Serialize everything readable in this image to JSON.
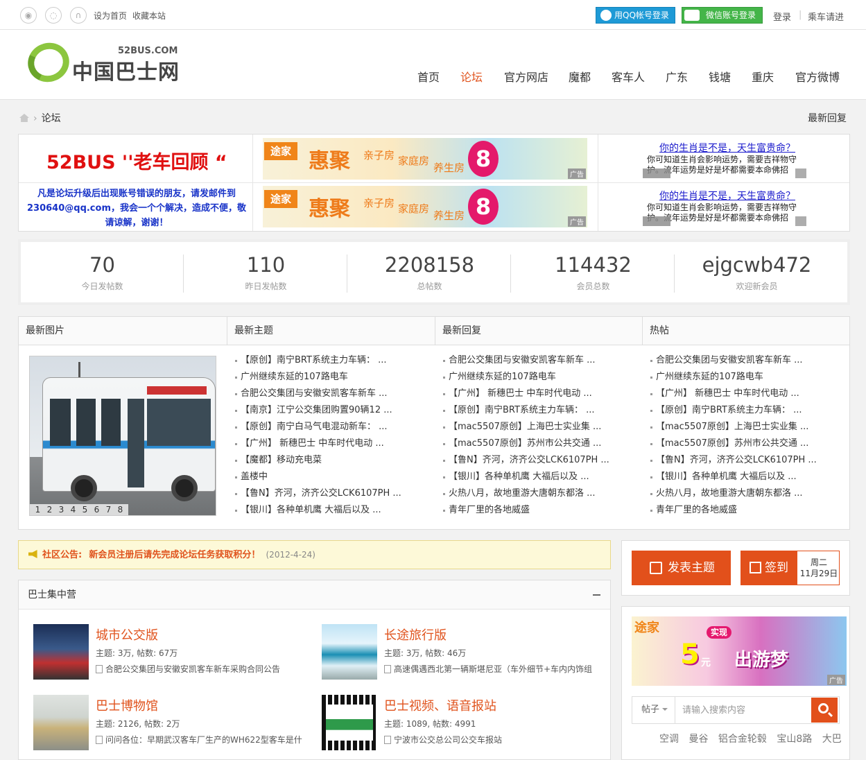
{
  "topbar": {
    "set_home": "设为首页",
    "bookmark": "收藏本站",
    "qq_login": "用QQ帐号登录",
    "wechat_login": "微信账号登录",
    "login": "登录",
    "sep": "|",
    "register": "乘车请进"
  },
  "logo": {
    "text": "中国巴士网",
    "sub": "52BUS.COM"
  },
  "nav": [
    "首页",
    "论坛",
    "官方网店",
    "魔都",
    "客车人",
    "广东",
    "钱塘",
    "重庆",
    "官方微博"
  ],
  "breadcrumb": {
    "current": "论坛",
    "right": "最新回复"
  },
  "ads": {
    "left_title": "52BUS ''老车回顾 “",
    "left_note": "凡是论坛升级后出现账号错误的朋友，请发邮件到230640@qq.com，我会一个个解决，造成不便，敬请谅解，谢谢！",
    "banner_brand": "途家",
    "banner_main": "惠聚",
    "banner_t1": "亲子房",
    "banner_t2": "家庭房",
    "banner_t3": "养生房",
    "banner_num": "8",
    "ad_label": "广告",
    "text_title": "你的生肖是不是，天生富贵命？",
    "text_body": "你可知道生肖会影响运势，需要吉祥物守护。流年运势是好是坏都需要本命佛招"
  },
  "stats": [
    {
      "value": "70",
      "label": "今日发帖数"
    },
    {
      "value": "110",
      "label": "昨日发帖数"
    },
    {
      "value": "2208158",
      "label": "总帖数"
    },
    {
      "value": "114432",
      "label": "会员总数"
    },
    {
      "value": "ejgcwb472",
      "label": "欢迎新会员"
    }
  ],
  "panel": {
    "h_pics": "最新图片",
    "h_topics": "最新主题",
    "h_replies": "最新回复",
    "h_hot": "热帖",
    "pages": [
      "1",
      "2",
      "3",
      "4",
      "5",
      "6",
      "7",
      "8"
    ],
    "topics": [
      "【原创】南宁BRT系统主力车辆： ...",
      "广州继续东延的107路电车",
      "合肥公交集团与安徽安凯客车新车 ...",
      "【南京】江宁公交集团购置90辆12 ...",
      "【原创】南宁白马气电混动新车： ...",
      "【广州】 新穗巴士 中车时代电动 ...",
      "【魔都】移动充电菜",
      "盖楼中",
      "【鲁N】齐河，济齐公交LCK6107PH ...",
      "【银川】各种单机鹰 大福后以及 ..."
    ],
    "replies": [
      "合肥公交集团与安徽安凯客车新车 ...",
      "广州继续东延的107路电车",
      "【广州】 新穗巴士 中车时代电动 ...",
      "【原创】南宁BRT系统主力车辆： ...",
      "【mac5507原创】上海巴士实业集 ...",
      "【mac5507原创】苏州市公共交通 ...",
      "【鲁N】齐河，济齐公交LCK6107PH ...",
      "【银川】各种单机鹰 大福后以及 ...",
      "火热八月，故地重游大唐朝东都洛 ...",
      "青年厂里的各地威盛"
    ],
    "hot": [
      "合肥公交集团与安徽安凯客车新车 ...",
      "广州继续东延的107路电车",
      "【广州】 新穗巴士 中车时代电动 ...",
      "【原创】南宁BRT系统主力车辆： ...",
      "【mac5507原创】上海巴士实业集 ...",
      "【mac5507原创】苏州市公共交通 ...",
      "【鲁N】齐河，济齐公交LCK6107PH ...",
      "【银川】各种单机鹰 大福后以及 ...",
      "火热八月，故地重游大唐朝东都洛 ...",
      "青年厂里的各地威盛"
    ]
  },
  "notice": {
    "label": "社区公告:",
    "message": "新会员注册后请先完成论坛任务获取积分！",
    "date": "(2012-4-24)"
  },
  "actions": {
    "post": "发表主题",
    "sign": "签到",
    "weekday": "周二",
    "date": "11月29日"
  },
  "board": {
    "title": "巴士集中营",
    "forums": [
      {
        "name": "城市公交版",
        "stats": "主题: 3万, 帖数: 67万",
        "last": "合肥公交集团与安徽安凯客车新车采购合同公告"
      },
      {
        "name": "长途旅行版",
        "stats": "主题: 3万, 帖数: 46万",
        "last": "高速偶遇西北第一辆斯堪尼亚（车外细节+车内内饰组"
      },
      {
        "name": "巴士博物馆",
        "stats": "主题: 2126, 帖数: 2万",
        "last": "问问各位：早期武汉客车厂生产的WH622型客车是什"
      },
      {
        "name": "巴士视频、语音报站",
        "stats": "主题: 1089, 帖数: 4991",
        "last": "宁波市公交总公司公交车报站"
      }
    ]
  },
  "side_ad": {
    "brand": "途家",
    "badge": "实现",
    "num": "5",
    "unit": "元",
    "text": "出游梦",
    "ad_label": "广告"
  },
  "search": {
    "type": "帖子",
    "placeholder": "请输入搜索内容",
    "hot": [
      "空调",
      "曼谷",
      "铝合金轮毂",
      "宝山8路",
      "大巴"
    ]
  },
  "colors": {
    "accent": "#e0531d",
    "qq": "#1e9ad6",
    "wechat": "#44b549",
    "notice_bg": "#fdf9d8"
  }
}
